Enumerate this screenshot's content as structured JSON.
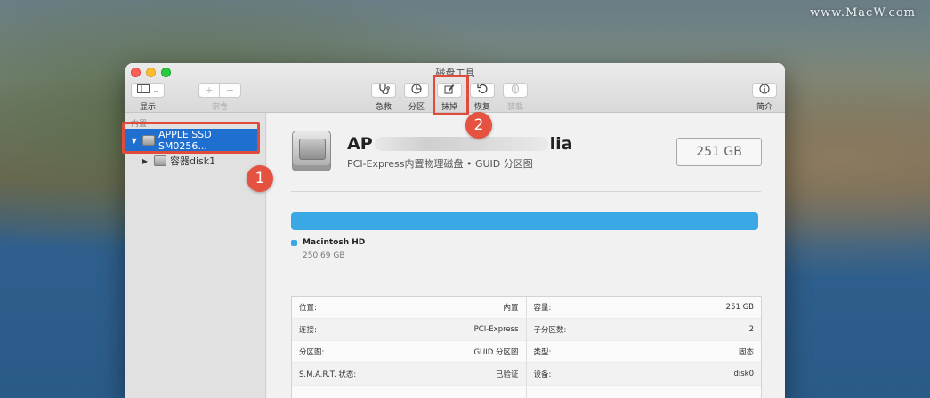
{
  "watermark": "www.MacW.com",
  "window": {
    "title": "磁盘工具"
  },
  "toolbar": {
    "view_label": "显示",
    "volume_label": "宗卷",
    "firstaid_label": "急救",
    "partition_label": "分区",
    "erase_label": "抹掉",
    "restore_label": "恢复",
    "mount_label": "装载",
    "info_label": "简介"
  },
  "sidebar": {
    "section_header": "内置",
    "items": [
      {
        "label": "APPLE SSD SM0256..."
      },
      {
        "label": "容器disk1"
      }
    ]
  },
  "disk": {
    "name_prefix": "AP",
    "name_suffix": "lia",
    "subtitle": "PCI-Express内置物理磁盘 • GUID 分区图",
    "size": "251 GB"
  },
  "volume": {
    "name": "Macintosh HD",
    "size": "250.69 GB"
  },
  "details": {
    "left": [
      {
        "k": "位置:",
        "v": "内置"
      },
      {
        "k": "连接:",
        "v": "PCI-Express"
      },
      {
        "k": "分区图:",
        "v": "GUID 分区图"
      },
      {
        "k": "S.M.A.R.T. 状态:",
        "v": "已验证"
      }
    ],
    "right": [
      {
        "k": "容量:",
        "v": "251 GB"
      },
      {
        "k": "子分区数:",
        "v": "2"
      },
      {
        "k": "类型:",
        "v": "固态"
      },
      {
        "k": "设备:",
        "v": "disk0"
      }
    ]
  },
  "annotations": {
    "badge1": "1",
    "badge2": "2"
  },
  "colors": {
    "selection": "#1f6fd1",
    "usage_bar": "#3aa8e5",
    "annotation": "#e04b3a"
  }
}
